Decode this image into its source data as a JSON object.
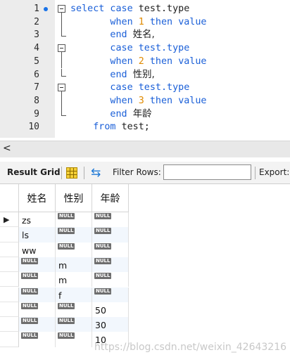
{
  "editor": {
    "lines": [
      {
        "num": "1",
        "breakpoint": true,
        "fold": "start",
        "tokens": [
          {
            "t": "select case ",
            "c": "kw"
          },
          {
            "t": "test.type",
            "c": "id"
          }
        ]
      },
      {
        "num": "2",
        "fold": "mid",
        "tokens": [
          {
            "t": "       when ",
            "c": "kw"
          },
          {
            "t": "1",
            "c": "num"
          },
          {
            "t": " then ",
            "c": "kw"
          },
          {
            "t": "value",
            "c": "kw"
          }
        ]
      },
      {
        "num": "3",
        "fold": "end",
        "tokens": [
          {
            "t": "       end ",
            "c": "kw"
          },
          {
            "t": "姓名,",
            "c": "cjk"
          }
        ]
      },
      {
        "num": "4",
        "fold": "start",
        "tokens": [
          {
            "t": "       case ",
            "c": "kw"
          },
          {
            "t": "test.type",
            "c": "kw"
          }
        ]
      },
      {
        "num": "5",
        "fold": "mid",
        "tokens": [
          {
            "t": "       when ",
            "c": "kw"
          },
          {
            "t": "2",
            "c": "num"
          },
          {
            "t": " then ",
            "c": "kw"
          },
          {
            "t": "value",
            "c": "kw"
          }
        ]
      },
      {
        "num": "6",
        "fold": "end",
        "tokens": [
          {
            "t": "       end ",
            "c": "kw"
          },
          {
            "t": "性别,",
            "c": "cjk"
          }
        ]
      },
      {
        "num": "7",
        "fold": "start",
        "tokens": [
          {
            "t": "       case ",
            "c": "kw"
          },
          {
            "t": "test.type",
            "c": "kw"
          }
        ]
      },
      {
        "num": "8",
        "fold": "mid",
        "tokens": [
          {
            "t": "       when ",
            "c": "kw"
          },
          {
            "t": "3",
            "c": "num"
          },
          {
            "t": " then ",
            "c": "kw"
          },
          {
            "t": "value",
            "c": "kw"
          }
        ]
      },
      {
        "num": "9",
        "fold": "end",
        "tokens": [
          {
            "t": "       end ",
            "c": "kw"
          },
          {
            "t": "年龄",
            "c": "cjk"
          }
        ]
      },
      {
        "num": "10",
        "fold": "none",
        "tokens": [
          {
            "t": "    from ",
            "c": "kw"
          },
          {
            "t": "test;",
            "c": "id"
          }
        ]
      }
    ]
  },
  "scrollbar": {
    "left_arrow": "<"
  },
  "toolbar": {
    "result_grid_label": "Result Grid",
    "filter_rows_label": "Filter Rows:",
    "filter_value": "",
    "export_label": "Export:",
    "grid_icon": "grid-table-icon",
    "refresh_icon": "refresh-icon"
  },
  "grid": {
    "columns": [
      "姓名",
      "性别",
      "年龄"
    ],
    "null_label": "NULL",
    "current_row_marker": "▶",
    "rows": [
      [
        "zs",
        null,
        null
      ],
      [
        "ls",
        null,
        null
      ],
      [
        "ww",
        null,
        null
      ],
      [
        null,
        "m",
        null
      ],
      [
        null,
        "m",
        null
      ],
      [
        null,
        "f",
        null
      ],
      [
        null,
        null,
        "50"
      ],
      [
        null,
        null,
        "30"
      ],
      [
        null,
        null,
        "10"
      ]
    ]
  },
  "watermark": "https://blog.csdn.net/weixin_42643216",
  "colors": {
    "keyword": "#1a5fd8",
    "number": "#e08a00",
    "null_badge": "#6e6e6e",
    "alt_row": "#f2f7fd"
  }
}
